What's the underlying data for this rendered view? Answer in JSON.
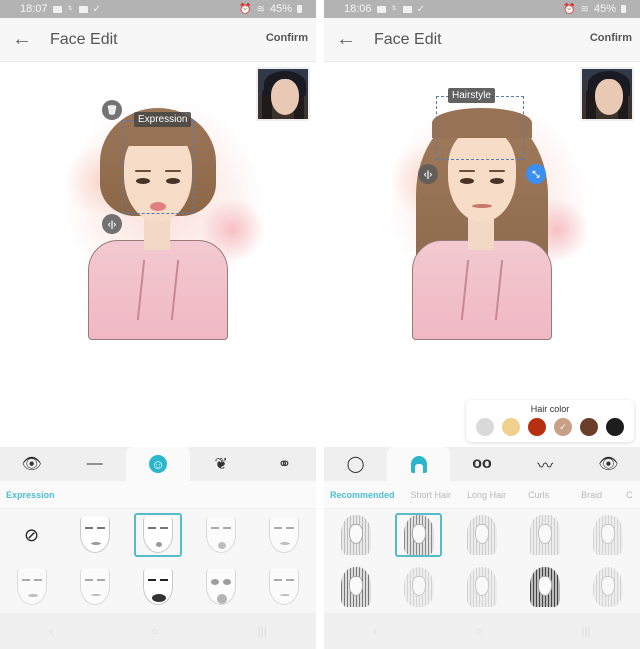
{
  "left": {
    "status": {
      "time": "18:07",
      "battery": "45%"
    },
    "appbar": {
      "back_icon": "←",
      "title": "Face Edit",
      "confirm_label": "Confirm"
    },
    "canvas": {
      "selection_label": "Expression",
      "delete_icon": "🗑",
      "move_icon": "‹|›"
    },
    "tabs": [
      {
        "name": "eye-icon",
        "glyph": "👁"
      },
      {
        "name": "eyebrow-icon",
        "glyph": "—"
      },
      {
        "name": "expression-icon",
        "glyph": "☺",
        "active": true
      },
      {
        "name": "beard-icon",
        "glyph": "❦"
      },
      {
        "name": "accessory-icon",
        "glyph": "⚭"
      }
    ],
    "subtabs": [
      "Expression"
    ],
    "grid_items": [
      "None",
      "Expression 1",
      "Expression 2",
      "Expression 3",
      "Expression 4",
      "Expression 5",
      "Expression 6",
      "Expression 7",
      "Expression 8",
      "Expression 9"
    ],
    "none_icon": "⊘"
  },
  "right": {
    "status": {
      "time": "18:06",
      "battery": "45%"
    },
    "appbar": {
      "back_icon": "←",
      "title": "Face Edit",
      "confirm_label": "Confirm"
    },
    "canvas": {
      "selection_label": "Hairstyle",
      "move_icon": "‹|›",
      "resize_icon": "⤡"
    },
    "hair_color": {
      "title": "Hair color",
      "swatches": [
        "#d9d9d9",
        "#efd08c",
        "#b6300f",
        "#c8a088",
        "#6b3e2b",
        "#1d1d1d"
      ],
      "selected_index": 3,
      "check_icon": "✓"
    },
    "tabs": [
      {
        "name": "face-shape-icon",
        "glyph": "◯"
      },
      {
        "name": "hair-icon",
        "glyph": "∩",
        "active": true
      },
      {
        "name": "glasses-icon",
        "glyph": "oo"
      },
      {
        "name": "mustache-icon",
        "glyph": "〰"
      },
      {
        "name": "eye-icon",
        "glyph": "👁"
      }
    ],
    "subtabs": [
      "Recommended",
      "Short Hair",
      "Long Hair",
      "Curls",
      "Braid",
      "C"
    ],
    "grid_items": [
      "Hairstyle 1",
      "Hairstyle 2",
      "Hairstyle 3",
      "Hairstyle 4",
      "Hairstyle 5",
      "Hairstyle 6",
      "Hairstyle 7",
      "Hairstyle 8",
      "Hairstyle 9",
      "Hairstyle 10"
    ],
    "selected_grid_index": 1
  },
  "navbar": {
    "back": "‹",
    "home": "○",
    "recents": "|||"
  },
  "accent_color": "#2bb6cc"
}
